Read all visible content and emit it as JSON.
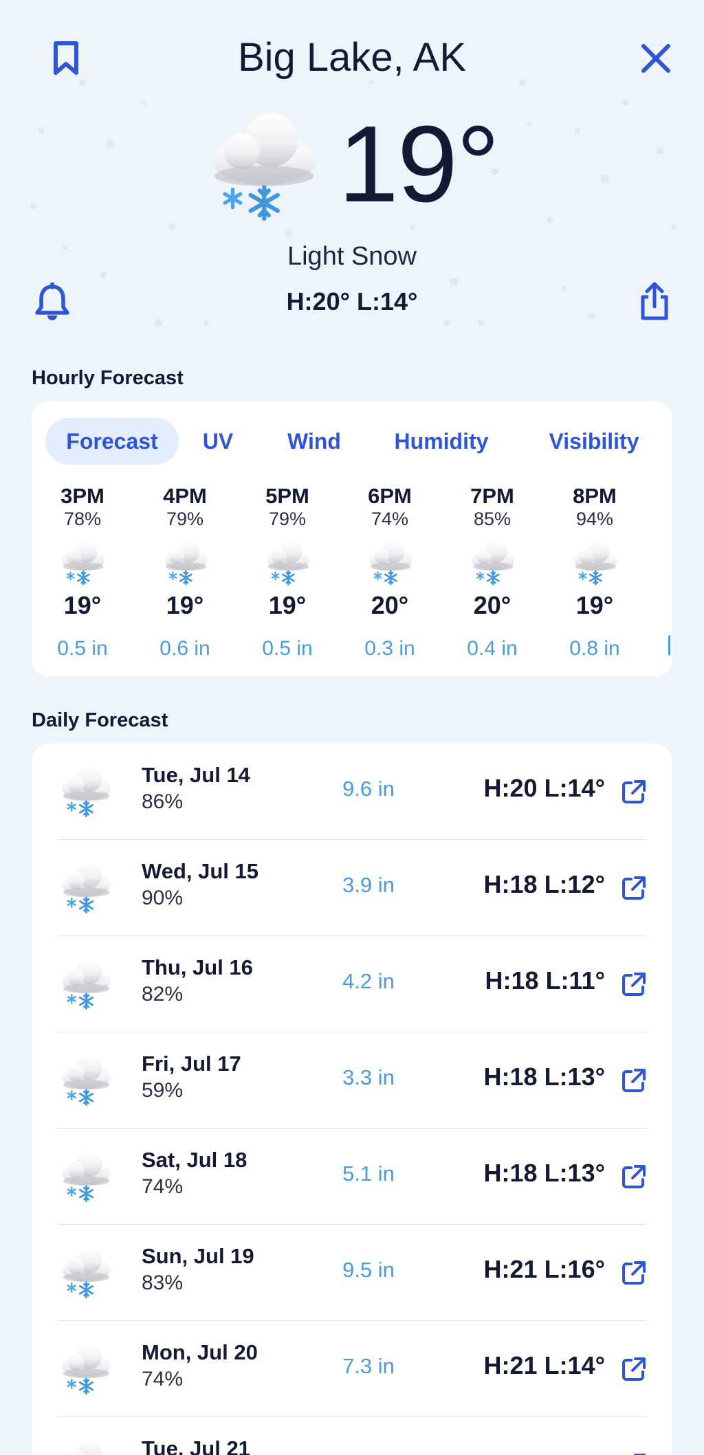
{
  "header": {
    "city": "Big Lake, AK",
    "temperature": "19°",
    "condition": "Light Snow",
    "high_low": "H:20° L:14°",
    "icons": {
      "bookmark": "bookmark-icon",
      "close": "close-icon",
      "bell": "bell-icon",
      "share": "share-icon",
      "weather": "snow-cloud-icon"
    }
  },
  "colors": {
    "accent": "#2f55d4",
    "precip": "#4a9be0",
    "background": "#eef4fc",
    "card": "#ffffff",
    "tab_active_bg": "#e3edfb"
  },
  "hourly": {
    "title": "Hourly Forecast",
    "tabs": [
      {
        "label": "Forecast",
        "active": true
      },
      {
        "label": "UV",
        "active": false
      },
      {
        "label": "Wind",
        "active": false
      },
      {
        "label": "Humidity",
        "active": false
      },
      {
        "label": "Visibility",
        "active": false
      }
    ],
    "hours": [
      {
        "time": "3PM",
        "humidity": "78%",
        "temp": "19°",
        "precip": "0.5 in"
      },
      {
        "time": "4PM",
        "humidity": "79%",
        "temp": "19°",
        "precip": "0.6 in"
      },
      {
        "time": "5PM",
        "humidity": "79%",
        "temp": "19°",
        "precip": "0.5 in"
      },
      {
        "time": "6PM",
        "humidity": "74%",
        "temp": "20°",
        "precip": "0.3 in"
      },
      {
        "time": "7PM",
        "humidity": "85%",
        "temp": "20°",
        "precip": "0.4 in"
      },
      {
        "time": "8PM",
        "humidity": "94%",
        "temp": "19°",
        "precip": "0.8 in"
      }
    ]
  },
  "daily": {
    "title": "Daily Forecast",
    "days": [
      {
        "date": "Tue, Jul 14",
        "humidity": "86%",
        "precip": "9.6 in",
        "high_low": "H:20 L:14°"
      },
      {
        "date": "Wed, Jul 15",
        "humidity": "90%",
        "precip": "3.9 in",
        "high_low": "H:18 L:12°"
      },
      {
        "date": "Thu, Jul 16",
        "humidity": "82%",
        "precip": "4.2 in",
        "high_low": "H:18 L:11°"
      },
      {
        "date": "Fri, Jul 17",
        "humidity": "59%",
        "precip": "3.3 in",
        "high_low": "H:18 L:13°"
      },
      {
        "date": "Sat, Jul 18",
        "humidity": "74%",
        "precip": "5.1 in",
        "high_low": "H:18 L:13°"
      },
      {
        "date": "Sun, Jul 19",
        "humidity": "83%",
        "precip": "9.5 in",
        "high_low": "H:21 L:16°"
      },
      {
        "date": "Mon, Jul 20",
        "humidity": "74%",
        "precip": "7.3 in",
        "high_low": "H:21 L:14°"
      },
      {
        "date": "Tue, Jul 21",
        "humidity": "",
        "precip": "",
        "high_low": ""
      }
    ]
  }
}
